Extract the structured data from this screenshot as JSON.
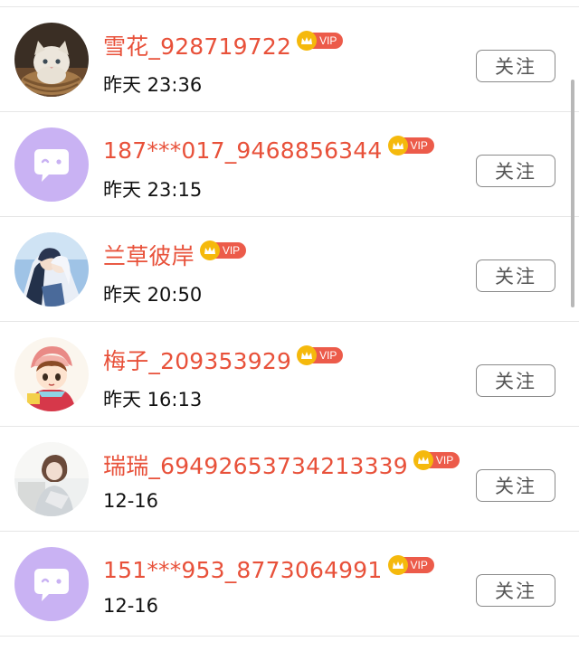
{
  "follow_label": "关注",
  "vip_label": "VIP",
  "colors": {
    "name": "#e8513a",
    "vip_crown": "#f5b90c",
    "vip_pill": "#ec5b4a",
    "default_avatar_bg": "#c9b2f3"
  },
  "users": [
    {
      "name": "雪花_928719722",
      "time": "昨天 23:36",
      "avatar": "kitten-photo"
    },
    {
      "name": "187***017_9468856344",
      "time": "昨天 23:15",
      "avatar": "default-chat-avatar"
    },
    {
      "name": "兰草彼岸",
      "time": "昨天 20:50",
      "avatar": "anime-couple-photo"
    },
    {
      "name": "梅子_209353929",
      "time": "昨天 16:13",
      "avatar": "anime-girl-drawing"
    },
    {
      "name": "瑞瑞_69492653734213339",
      "time": "12-16",
      "avatar": "girl-photo"
    },
    {
      "name": "151***953_8773064991",
      "time": "12-16",
      "avatar": "default-chat-avatar"
    }
  ]
}
